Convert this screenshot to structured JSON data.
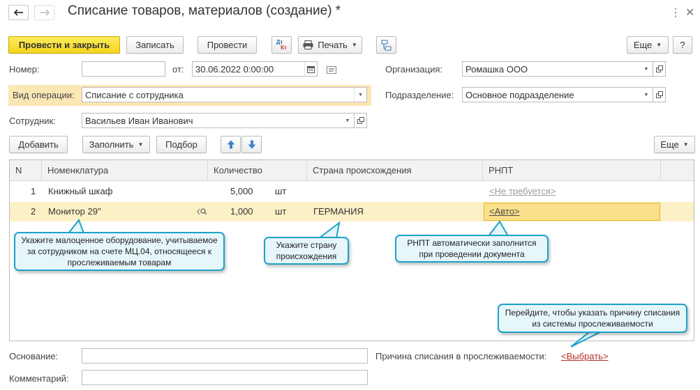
{
  "window": {
    "title": "Списание товаров, материалов (создание) *",
    "back_icon": "arrow-left-icon",
    "forward_icon": "arrow-right-icon",
    "menu_icon": "kebab-icon",
    "close_icon": "close-icon"
  },
  "toolbar": {
    "post_close_label": "Провести и закрыть",
    "write_label": "Записать",
    "post_label": "Провести",
    "dtkt_label_top": "Дт",
    "dtkt_label_bottom": "Кт",
    "print_label": "Печать",
    "more_label": "Еще",
    "help_label": "?"
  },
  "form": {
    "number_label": "Номер:",
    "number_value": "",
    "date_label": "от:",
    "date_value": "30.06.2022  0:00:00",
    "org_label": "Организация:",
    "org_value": "Ромашка ООО",
    "op_label": "Вид операции:",
    "op_value": "Списание с сотрудника",
    "dept_label": "Подразделение:",
    "dept_value": "Основное подразделение",
    "employee_label": "Сотрудник:",
    "employee_value": "Васильев Иван Иванович"
  },
  "table_toolbar": {
    "add_label": "Добавить",
    "fill_label": "Заполнить",
    "select_label": "Подбор",
    "more_label": "Еще"
  },
  "table": {
    "columns": [
      "N",
      "Номенклатура",
      "Количество",
      "Страна происхождения",
      "РНПТ"
    ],
    "rows": [
      {
        "n": "1",
        "item": "Книжный шкаф",
        "qty": "5,000",
        "unit": "шт",
        "country": "",
        "rnpt": "<Не требуется>"
      },
      {
        "n": "2",
        "item": "Монитор 29\"",
        "qty": "1,000",
        "unit": "шт",
        "country": "ГЕРМАНИЯ",
        "rnpt": "<Авто>"
      }
    ]
  },
  "callouts": {
    "equipment": "Укажите малоценное оборудование, учитываемое за сотрудником на счете МЦ.04, относящееся к прослеживаемым товарам",
    "country": "Укажите страну происхождения",
    "rnpt": "РНПТ автоматически заполнится при проведении документа",
    "reason": "Перейдите, чтобы указать причину списания из системы прослеживаемости"
  },
  "footer": {
    "basis_label": "Основание:",
    "basis_value": "",
    "reason_label": "Причина списания в прослеживаемости:",
    "reason_link": "<Выбрать>",
    "comment_label": "Комментарий:",
    "comment_value": ""
  },
  "colors": {
    "primary_button": "#f5d51e",
    "highlight_row": "#fbf0c6",
    "highlight_label": "#fbe7b4",
    "callout_border": "#1aa3c8",
    "callout_bg": "#e7f6fa",
    "link_red": "#b0302a"
  }
}
